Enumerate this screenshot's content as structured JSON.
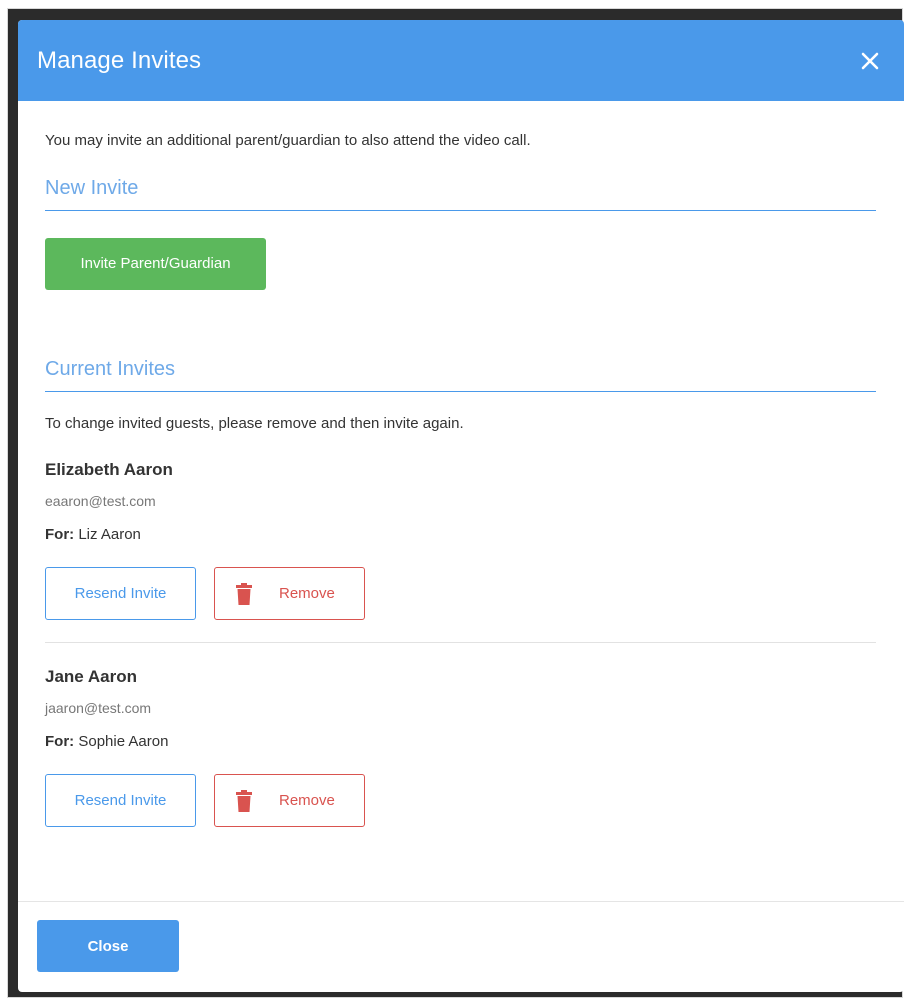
{
  "modal": {
    "title": "Manage Invites",
    "close_icon": "close-icon"
  },
  "intro_text": "You may invite an additional parent/guardian to also attend the video call.",
  "new_invite": {
    "heading": "New Invite",
    "button_label": "Invite Parent/Guardian"
  },
  "current_invites": {
    "heading": "Current Invites",
    "hint": "To change invited guests, please remove and then invite again.",
    "items": [
      {
        "name": "Elizabeth Aaron",
        "email": "eaaron@test.com",
        "for_label": "For:",
        "for_name": "Liz Aaron",
        "resend_label": "Resend Invite",
        "remove_label": "Remove"
      },
      {
        "name": "Jane Aaron",
        "email": "jaaron@test.com",
        "for_label": "For:",
        "for_name": "Sophie Aaron",
        "resend_label": "Resend Invite",
        "remove_label": "Remove"
      }
    ]
  },
  "footer": {
    "close_label": "Close"
  },
  "colors": {
    "header_blue": "#4a99ea",
    "success_green": "#5cb85c",
    "danger_red": "#d9534f",
    "section_heading_blue": "#6ea9e8"
  },
  "icons": {
    "remove": "trash-icon"
  }
}
